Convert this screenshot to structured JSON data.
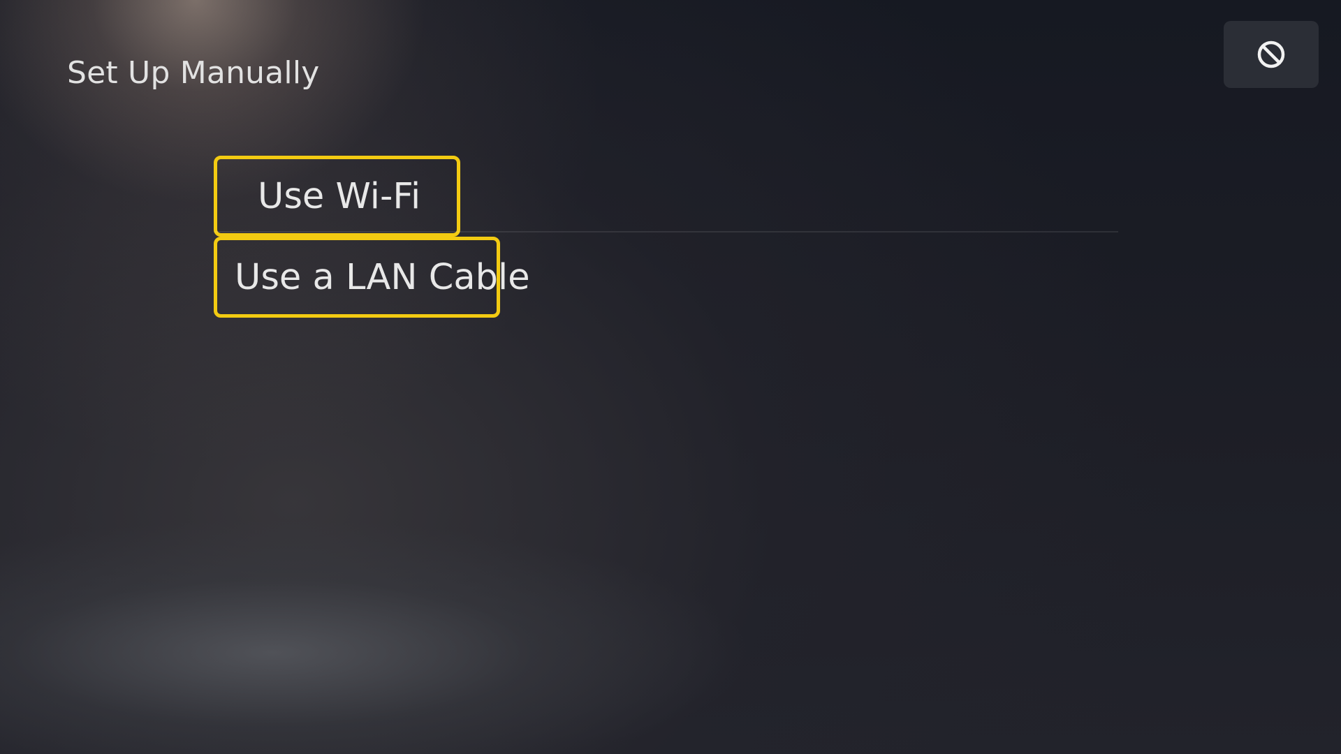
{
  "header": {
    "title": "Set Up Manually"
  },
  "menu": {
    "items": [
      {
        "label": "Use Wi-Fi"
      },
      {
        "label": "Use a LAN Cable"
      }
    ]
  },
  "toolbar": {
    "cancel_icon": "no-entry-icon"
  },
  "colors": {
    "focus_border": "#f3cb12",
    "text": "#e8e8e8"
  }
}
